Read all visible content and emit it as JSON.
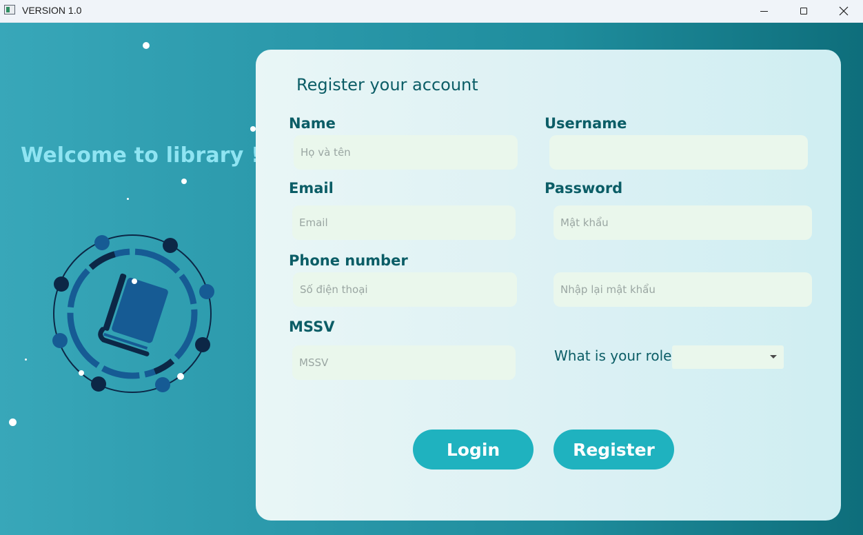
{
  "window": {
    "title": "VERSION 1.0",
    "controls": [
      "minimize-icon",
      "maximize-icon",
      "close-icon"
    ]
  },
  "sidebar": {
    "welcome": "Welcome to library !",
    "logo_icon": "book-orbit-icon"
  },
  "form": {
    "title": "Register your account",
    "name": {
      "label": "Name",
      "placeholder": "Họ và tên",
      "value": ""
    },
    "username": {
      "label": "Username",
      "placeholder": "",
      "value": ""
    },
    "email": {
      "label": "Email",
      "placeholder": "Email",
      "value": ""
    },
    "password": {
      "label": "Password",
      "placeholder": "Mật khẩu",
      "value": ""
    },
    "phone": {
      "label": "Phone number",
      "placeholder": "Số điện thoại",
      "value": ""
    },
    "confirm_password": {
      "placeholder": "Nhập lại mật khẩu",
      "value": ""
    },
    "mssv": {
      "label": "MSSV",
      "placeholder": "MSSV",
      "value": ""
    },
    "role": {
      "label": "What is your role?",
      "selected": ""
    }
  },
  "buttons": {
    "login": "Login",
    "register": "Register"
  },
  "colors": {
    "accent": "#1fb2bf",
    "heading": "#0b5d66",
    "field_bg": "#eaf7ec",
    "welcome_text": "#8fe4f2",
    "logo_dark": "#0c2746",
    "logo_blue": "#165b94"
  }
}
